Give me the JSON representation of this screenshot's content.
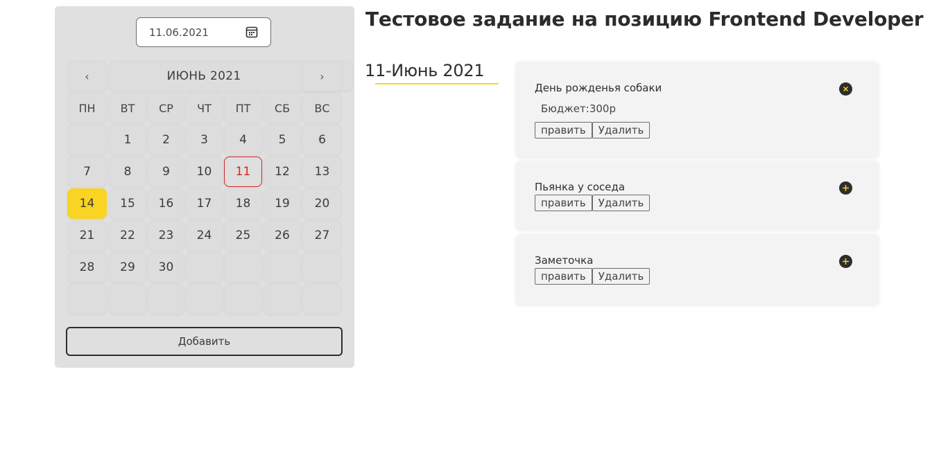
{
  "datepicker": {
    "value": "11.06.2021",
    "icon": "calendar-icon"
  },
  "calendar": {
    "month_label": "ИЮНЬ 2021",
    "prev": "‹",
    "next": "›",
    "weekdays": [
      "ПН",
      "ВТ",
      "СР",
      "ЧТ",
      "ПТ",
      "СБ",
      "ВС"
    ],
    "weeks": [
      [
        "",
        "1",
        "2",
        "3",
        "4",
        "5",
        "6"
      ],
      [
        "7",
        "8",
        "9",
        "10",
        "11",
        "12",
        "13"
      ],
      [
        "14",
        "15",
        "16",
        "17",
        "18",
        "19",
        "20"
      ],
      [
        "21",
        "22",
        "23",
        "24",
        "25",
        "26",
        "27"
      ],
      [
        "28",
        "29",
        "30",
        "",
        "",
        "",
        ""
      ],
      [
        "",
        "",
        "",
        "",
        "",
        "",
        ""
      ]
    ],
    "today": "11",
    "selected": "14",
    "add_label": "Добавить"
  },
  "page_title": "Тестовое задание на позицию Frontend Developer",
  "selected_date_heading": "11-Июнь 2021",
  "events": [
    {
      "name": "День рожденья собаки",
      "budget": "Бюджет:300р",
      "edit": "править",
      "delete": "Удалить",
      "toggle_icon": "close-icon"
    },
    {
      "name": "Пьянка у соседа",
      "edit": "править",
      "delete": "Удалить",
      "toggle_icon": "plus-icon"
    },
    {
      "name": "Заметочка",
      "edit": "править",
      "delete": "Удалить",
      "toggle_icon": "plus-icon"
    }
  ],
  "colors": {
    "accent": "#f9d423",
    "today": "#d42424",
    "dark": "#2d2d2d"
  }
}
